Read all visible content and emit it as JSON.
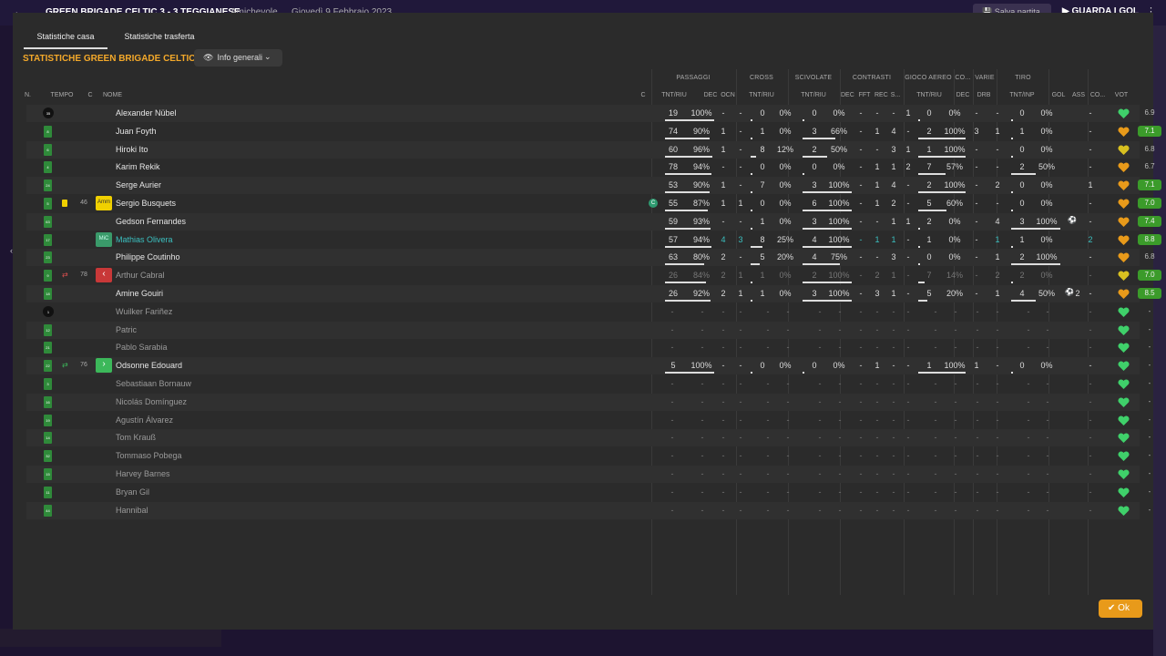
{
  "bg": {
    "match_title": "GREEN BRIGADE CELTIC 3 - 3 TEGGIANESE",
    "match_type": "Amichevole",
    "match_date": "Giovedì 9 Febbraio 2023",
    "save_label": "Salva partita",
    "watch_label": "GUARDA I GOL"
  },
  "tabs": [
    {
      "label": "Statistiche casa",
      "active": true
    },
    {
      "label": "Statistiche trasferta",
      "active": false
    }
  ],
  "team_title": "STATISTICHE GREEN BRIGADE CELTIC",
  "view_selector": "Info generali",
  "group_headers": [
    "PASSAGGI",
    "CROSS",
    "SCIVOLATE",
    "CONTRASTI",
    "GIOCO AEREO",
    "CO...",
    "VARIE",
    "TIRO"
  ],
  "col_headers": {
    "n": "N.",
    "tempo": "TEMPO",
    "c": "C",
    "nome": "NOME",
    "c2": "C",
    "pass_tnt": "TNT/RIU",
    "pass_dec": "DEC",
    "pass_ocn": "OCN",
    "cross_tnt": "TNT/RIU",
    "sciv_tnt": "TNT/RIU",
    "con_dec": "DEC",
    "con_fft": "FFT",
    "con_rec": "REC",
    "con_s": "S...",
    "aereo_tnt": "TNT/RIU",
    "co_dec": "DEC",
    "varie_drb": "DRB",
    "tiro_tnt": "TNT/INP",
    "gol": "GOL",
    "ass": "ASS",
    "cond": "CO...",
    "vot": "VOT"
  },
  "colors": {
    "accent": "#f4a92a",
    "ok": "#e89a1a",
    "good_rating": "#3b9b2a",
    "heart_green": "#3fd06a",
    "heart_orange": "#e89a1a",
    "heart_yellow": "#d8c020"
  },
  "players": [
    {
      "n": "35",
      "name": "Alexander Nübel",
      "gk": true,
      "pass": [
        "19",
        "100%"
      ],
      "pass_dec": "-",
      "pass_ocn": "-",
      "cross": [
        "0",
        "0%"
      ],
      "sciv": [
        "0",
        "0%"
      ],
      "con": [
        "-",
        "-",
        "-",
        "1"
      ],
      "aereo": [
        "0",
        "0%"
      ],
      "co": "-",
      "drb": "-",
      "tiro": [
        "0",
        "0%"
      ],
      "gol": "",
      "ass": "-",
      "heart": "green",
      "vot": "6.9"
    },
    {
      "n": "8",
      "name": "Juan Foyth",
      "pass": [
        "74",
        "90%"
      ],
      "pass_dec": "1",
      "pass_ocn": "-",
      "cross": [
        "1",
        "0%"
      ],
      "sciv": [
        "3",
        "66%"
      ],
      "con": [
        "-",
        "1",
        "4",
        "-"
      ],
      "aereo": [
        "2",
        "100%"
      ],
      "co": "3",
      "drb": "1",
      "tiro": [
        "1",
        "0%"
      ],
      "gol": "",
      "ass": "-",
      "heart": "orange",
      "vot": "7.1"
    },
    {
      "n": "6",
      "name": "Hiroki Ito",
      "pass": [
        "60",
        "96%"
      ],
      "pass_dec": "1",
      "pass_ocn": "-",
      "cross": [
        "8",
        "12%"
      ],
      "sciv": [
        "2",
        "50%"
      ],
      "con": [
        "-",
        "-",
        "3",
        "1"
      ],
      "aereo": [
        "1",
        "100%"
      ],
      "co": "-",
      "drb": "-",
      "tiro": [
        "0",
        "0%"
      ],
      "gol": "",
      "ass": "-",
      "heart": "yellow",
      "vot": "6.8"
    },
    {
      "n": "4",
      "name": "Karim Rekik",
      "pass": [
        "78",
        "94%"
      ],
      "pass_dec": "-",
      "pass_ocn": "-",
      "cross": [
        "0",
        "0%"
      ],
      "sciv": [
        "0",
        "0%"
      ],
      "con": [
        "-",
        "1",
        "1",
        "2"
      ],
      "aereo": [
        "7",
        "57%"
      ],
      "co": "-",
      "drb": "-",
      "tiro": [
        "2",
        "50%"
      ],
      "gol": "",
      "ass": "-",
      "heart": "orange",
      "vot": "6.7"
    },
    {
      "n": "24",
      "name": "Serge Aurier",
      "pass": [
        "53",
        "90%"
      ],
      "pass_dec": "1",
      "pass_ocn": "-",
      "cross": [
        "7",
        "0%"
      ],
      "sciv": [
        "3",
        "100%"
      ],
      "con": [
        "-",
        "1",
        "4",
        "-"
      ],
      "aereo": [
        "2",
        "100%"
      ],
      "co": "-",
      "drb": "2",
      "tiro": [
        "0",
        "0%"
      ],
      "gol": "",
      "ass": "1",
      "heart": "orange",
      "vot": "7.1"
    },
    {
      "n": "5",
      "name": "Sergio Busquets",
      "ycard": true,
      "tempo": "46",
      "badge": "Amm",
      "captain": true,
      "pass": [
        "55",
        "87%"
      ],
      "pass_dec": "1",
      "pass_ocn": "1",
      "cross": [
        "0",
        "0%"
      ],
      "sciv": [
        "6",
        "100%"
      ],
      "con": [
        "-",
        "1",
        "2",
        "-"
      ],
      "aereo": [
        "5",
        "60%"
      ],
      "co": "-",
      "drb": "-",
      "tiro": [
        "0",
        "0%"
      ],
      "gol": "",
      "ass": "-",
      "heart": "orange",
      "vot": "7.0"
    },
    {
      "n": "63",
      "name": "Gedson Fernandes",
      "pass": [
        "59",
        "93%"
      ],
      "pass_dec": "-",
      "pass_ocn": "-",
      "cross": [
        "1",
        "0%"
      ],
      "sciv": [
        "3",
        "100%"
      ],
      "con": [
        "-",
        "-",
        "1",
        "1"
      ],
      "aereo": [
        "2",
        "0%"
      ],
      "co": "-",
      "drb": "4",
      "tiro": [
        "3",
        "100%"
      ],
      "gol": "ball",
      "ass": "-",
      "heart": "orange",
      "vot": "7.4"
    },
    {
      "n": "17",
      "name": "Mathias Olivera",
      "teal": true,
      "badge": "MiC",
      "pass": [
        "57",
        "94%"
      ],
      "pass_dec": "4",
      "pass_ocn": "3",
      "cross": [
        "8",
        "25%"
      ],
      "sciv": [
        "4",
        "100%"
      ],
      "con": [
        "-",
        "1",
        "1",
        "-"
      ],
      "aereo": [
        "1",
        "0%"
      ],
      "co": "-",
      "drb": "1",
      "tiro": [
        "1",
        "0%"
      ],
      "gol": "",
      "ass": "2",
      "heart": "orange",
      "vot": "8.8"
    },
    {
      "n": "23",
      "name": "Philippe Coutinho",
      "pass": [
        "63",
        "80%"
      ],
      "pass_dec": "2",
      "pass_ocn": "-",
      "cross": [
        "5",
        "20%"
      ],
      "sciv": [
        "4",
        "75%"
      ],
      "con": [
        "-",
        "-",
        "3",
        "-"
      ],
      "aereo": [
        "0",
        "0%"
      ],
      "co": "-",
      "drb": "1",
      "tiro": [
        "2",
        "100%"
      ],
      "gol": "",
      "ass": "-",
      "heart": "orange",
      "vot": "6.8"
    },
    {
      "n": "9",
      "name": "Arthur Cabral",
      "dim": true,
      "subout": true,
      "tempo": "78",
      "badge": "out",
      "pass": [
        "26",
        "84%"
      ],
      "pass_dec": "2",
      "pass_ocn": "1",
      "cross": [
        "1",
        "0%"
      ],
      "sciv": [
        "2",
        "100%"
      ],
      "con": [
        "-",
        "2",
        "1",
        "-"
      ],
      "aereo": [
        "7",
        "14%"
      ],
      "co": "-",
      "drb": "2",
      "tiro": [
        "2",
        "0%"
      ],
      "gol": "",
      "ass": "-",
      "heart": "yellow",
      "vot": "7.0"
    },
    {
      "n": "18",
      "name": "Amine Gouiri",
      "pass": [
        "26",
        "92%"
      ],
      "pass_dec": "2",
      "pass_ocn": "1",
      "cross": [
        "1",
        "0%"
      ],
      "sciv": [
        "3",
        "100%"
      ],
      "con": [
        "-",
        "3",
        "1",
        "-"
      ],
      "aereo": [
        "5",
        "20%"
      ],
      "co": "-",
      "drb": "1",
      "tiro": [
        "4",
        "50%"
      ],
      "gol": "ball2",
      "ass": "-",
      "heart": "orange",
      "vot": "8.5"
    },
    {
      "n": "1",
      "name": "Wuilker Fariñez",
      "gk": true,
      "dim": true,
      "empty": true,
      "heart": "green"
    },
    {
      "n": "12",
      "name": "Patric",
      "dim": true,
      "empty": true,
      "heart": "green"
    },
    {
      "n": "21",
      "name": "Pablo Sarabia",
      "dim": true,
      "empty": true,
      "heart": "green"
    },
    {
      "n": "22",
      "name": "Odsonne Edouard",
      "subin": true,
      "tempo": "76",
      "badge": "in",
      "pass": [
        "5",
        "100%"
      ],
      "pass_dec": "-",
      "pass_ocn": "-",
      "cross": [
        "0",
        "0%"
      ],
      "sciv": [
        "0",
        "0%"
      ],
      "con": [
        "-",
        "1",
        "-",
        "-"
      ],
      "aereo": [
        "1",
        "100%"
      ],
      "co": "1",
      "drb": "-",
      "tiro": [
        "0",
        "0%"
      ],
      "gol": "",
      "ass": "-",
      "heart": "green",
      "vot": "-"
    },
    {
      "n": "3",
      "name": "Sebastiaan Bornauw",
      "dim": true,
      "empty": true,
      "heart": "green"
    },
    {
      "n": "16",
      "name": "Nicolás Domínguez",
      "dim": true,
      "empty": true,
      "heart": "green"
    },
    {
      "n": "19",
      "name": "Agustín Álvarez",
      "dim": true,
      "empty": true,
      "heart": "green"
    },
    {
      "n": "14",
      "name": "Tom Krauß",
      "dim": true,
      "empty": true,
      "heart": "green"
    },
    {
      "n": "32",
      "name": "Tommaso Pobega",
      "dim": true,
      "empty": true,
      "heart": "green"
    },
    {
      "n": "15",
      "name": "Harvey Barnes",
      "dim": true,
      "empty": true,
      "heart": "green"
    },
    {
      "n": "11",
      "name": "Bryan Gil",
      "dim": true,
      "empty": true,
      "heart": "green"
    },
    {
      "n": "44",
      "name": "Hannibal",
      "dim": true,
      "empty": true,
      "heart": "green"
    }
  ],
  "ok_label": "Ok"
}
